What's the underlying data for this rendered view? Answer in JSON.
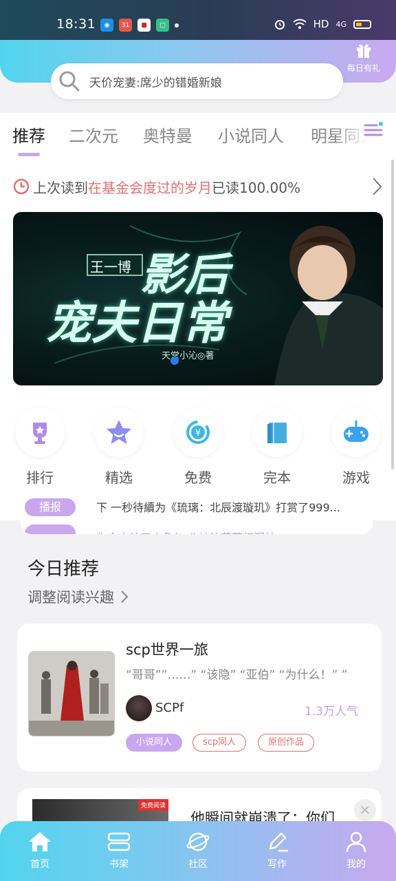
{
  "status_bar": {
    "time": "18:31",
    "network": "HD",
    "signal": "4G",
    "app_badge": "31"
  },
  "header": {
    "gift_label": "每日有礼",
    "search_placeholder": "天价宠妻:席少的错婚新娘"
  },
  "tabs": [
    {
      "label": "推荐",
      "active": true
    },
    {
      "label": "二次元",
      "active": false
    },
    {
      "label": "奥特曼",
      "active": false
    },
    {
      "label": "小说同人",
      "active": false
    },
    {
      "label": "明星同人",
      "active": false
    }
  ],
  "last_read": {
    "prefix": "上次读到",
    "book": "在基金会度过的岁月",
    "suffix": "已读100.00%"
  },
  "banner": {
    "line1": "王一博",
    "line2": "影后",
    "line3": "宠夫日常",
    "author": "天堂小沁◎著"
  },
  "categories": [
    {
      "label": "排行",
      "icon": "trophy-icon",
      "color": "#b18be8"
    },
    {
      "label": "精选",
      "icon": "star-icon",
      "color": "#8a8ef0"
    },
    {
      "label": "免费",
      "icon": "yen-refresh-icon",
      "color": "#3db6e6"
    },
    {
      "label": "完本",
      "icon": "book-icon",
      "color": "#44aee0"
    },
    {
      "label": "游戏",
      "icon": "gamepad-icon",
      "color": "#3aa2ea"
    }
  ],
  "broadcast": {
    "tag": "播报",
    "text": "下 一秒待續为《琉璃：北辰渡璇玑》打赏了999...",
    "next_text": "你个木神五山角与 北神泊花菊红洞纳"
  },
  "recommend": {
    "title": "今日推荐",
    "adjust_label": "调整阅读兴趣"
  },
  "books": [
    {
      "title": "scp世界一旅",
      "desc": "“哥哥””……” “该隐” “亚伯” “为什么！” ”",
      "author": "SCPf",
      "popularity": "1.3万人气",
      "tags": [
        "小说同人",
        "scp同人",
        "原创作品"
      ]
    },
    {
      "title": "他瞬间就崩溃了：你们...",
      "badge": "免费阅读"
    }
  ],
  "bottom_nav": [
    {
      "label": "首页",
      "icon": "home-icon"
    },
    {
      "label": "书架",
      "icon": "bookshelf-icon"
    },
    {
      "label": "社区",
      "icon": "planet-icon"
    },
    {
      "label": "写作",
      "icon": "pen-icon"
    },
    {
      "label": "我的",
      "icon": "user-icon"
    }
  ]
}
